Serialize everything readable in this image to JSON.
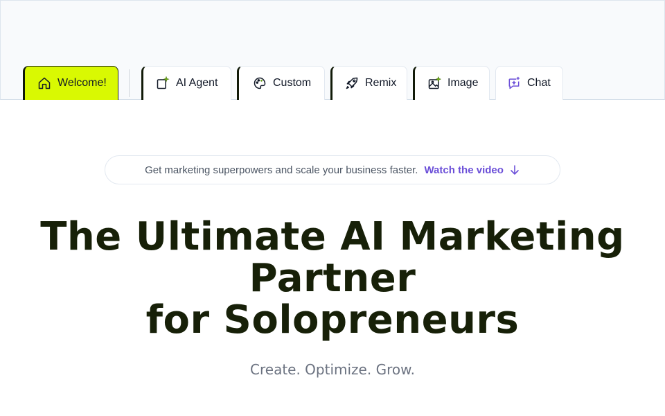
{
  "nav": {
    "tabs": [
      {
        "label": "Welcome!",
        "icon": "home-icon"
      },
      {
        "label": "AI Agent",
        "icon": "ai-agent-icon"
      },
      {
        "label": "Custom",
        "icon": "palette-icon"
      },
      {
        "label": "Remix",
        "icon": "rocket-icon"
      },
      {
        "label": "Image",
        "icon": "image-icon"
      },
      {
        "label": "Chat",
        "icon": "chat-sparkle-icon"
      }
    ],
    "active_color": "#d9f902"
  },
  "announcement": {
    "message": "Get marketing superpowers and scale your business faster.",
    "link_label": "Watch the video",
    "link_color": "#6b4fd8"
  },
  "hero": {
    "line1": "The Ultimate AI Marketing",
    "line2": "Partner",
    "line3": "for Solopreneurs",
    "subtitle": "Create. Optimize. Grow."
  }
}
